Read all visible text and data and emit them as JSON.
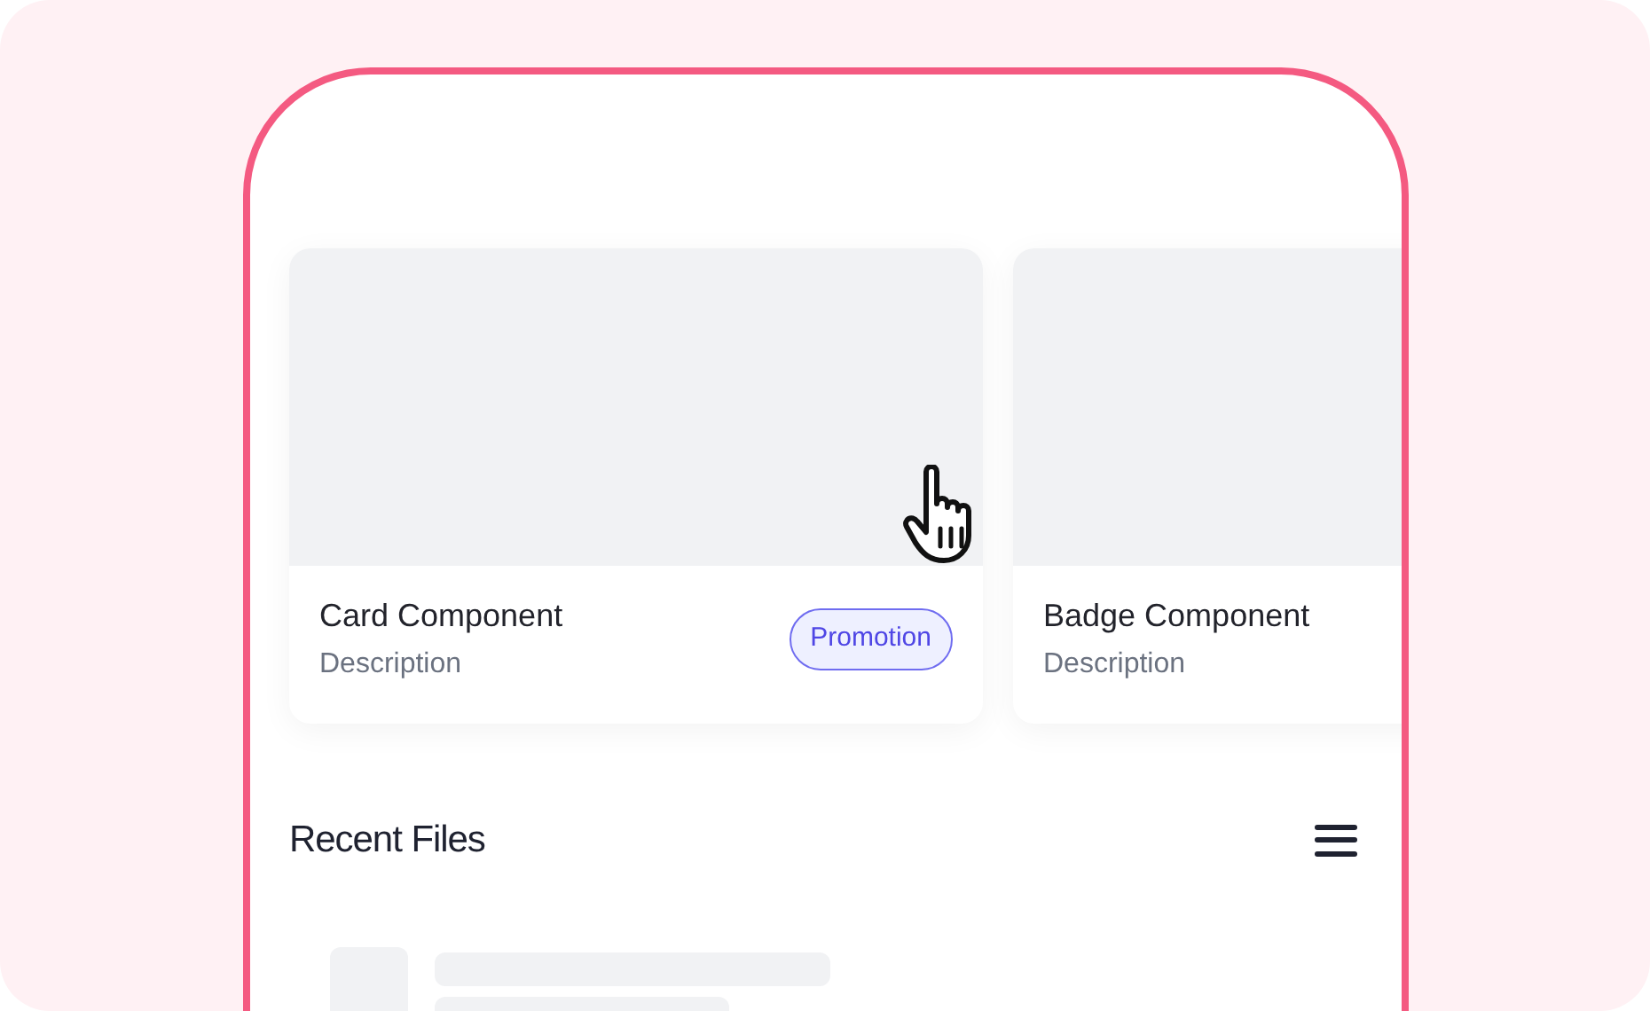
{
  "cards": [
    {
      "title": "Card Component",
      "description": "Description",
      "badge": "Promotion"
    },
    {
      "title": "Badge Component",
      "description": "Description"
    }
  ],
  "recent_files": {
    "title": "Recent Files",
    "items": [
      {
        "kind": "skeleton"
      }
    ]
  }
}
